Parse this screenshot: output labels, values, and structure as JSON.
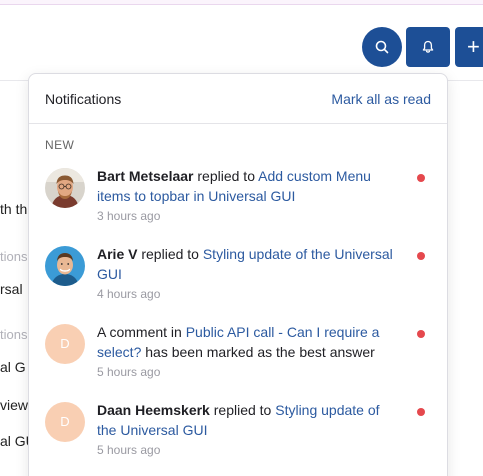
{
  "background_snippets": [
    {
      "text": "th th",
      "muted": false
    },
    {
      "text": "tions",
      "muted": true
    },
    {
      "text": "rsal",
      "muted": false
    },
    {
      "text": "tions",
      "muted": true
    },
    {
      "text": "al G",
      "muted": false
    },
    {
      "text": "view",
      "muted": false
    },
    {
      "text": "al GU",
      "muted": false
    }
  ],
  "header": {
    "search_icon": "search-icon",
    "bell_icon": "bell-icon",
    "plus_label": "+"
  },
  "notifications": {
    "title": "Notifications",
    "mark_all": "Mark all as read",
    "section": "NEW",
    "items": [
      {
        "avatar": "photo",
        "initial": "",
        "actor": "Bart Metselaar",
        "verb": " replied to ",
        "prefix": "",
        "link": "Add custom Menu items to topbar in Universal GUI",
        "suffix": "",
        "time": "3 hours ago",
        "unread": true
      },
      {
        "avatar": "photo",
        "initial": "",
        "actor": "Arie V",
        "verb": " replied to ",
        "prefix": "",
        "link": "Styling update of the Universal GUI",
        "suffix": "",
        "time": "4 hours ago",
        "unread": true
      },
      {
        "avatar": "initial",
        "initial": "D",
        "actor": "",
        "verb": "",
        "prefix": "A comment in ",
        "link": "Public API call - Can I require a select?",
        "suffix": " has been marked as the best answer",
        "time": "5 hours ago",
        "unread": true
      },
      {
        "avatar": "initial",
        "initial": "D",
        "actor": "Daan Heemskerk",
        "verb": " replied to ",
        "prefix": "",
        "link": "Styling update of the Universal GUI",
        "suffix": "",
        "time": "5 hours ago",
        "unread": true
      }
    ]
  },
  "colors": {
    "brand": "#1d4f96",
    "link": "#2c5aa0",
    "unread_dot": "#e5484d",
    "avatar_initial_bg": "#f9cfb3"
  }
}
